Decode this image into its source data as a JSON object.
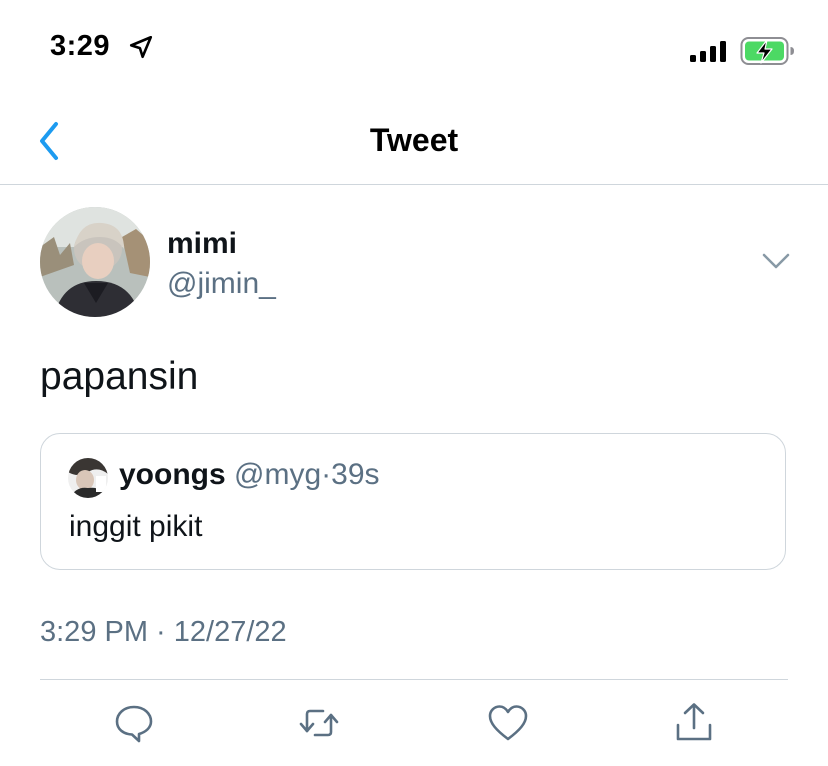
{
  "status_bar": {
    "time": "3:29",
    "icons": [
      "location-arrow-icon",
      "cellular-signal-icon",
      "battery-charging-icon"
    ],
    "battery_color": "#4cd964"
  },
  "nav": {
    "title": "Tweet",
    "back_icon": "chevron-left-icon"
  },
  "tweet": {
    "author": {
      "name": "mimi",
      "handle": "@jimin_"
    },
    "more_icon": "chevron-down-icon",
    "text": "papansin",
    "quote": {
      "name": "yoongs",
      "handle": "@myg",
      "separator": "·",
      "time": "39s",
      "text": "inggit pikit"
    },
    "timestamp": "3:29 PM · 12/27/22",
    "actions": [
      "reply-icon",
      "retweet-icon",
      "like-icon",
      "share-icon"
    ]
  },
  "colors": {
    "accent": "#1d9bf0",
    "text": "#0f1419",
    "secondary_text": "#5b7083",
    "border": "#cfd6dc"
  }
}
